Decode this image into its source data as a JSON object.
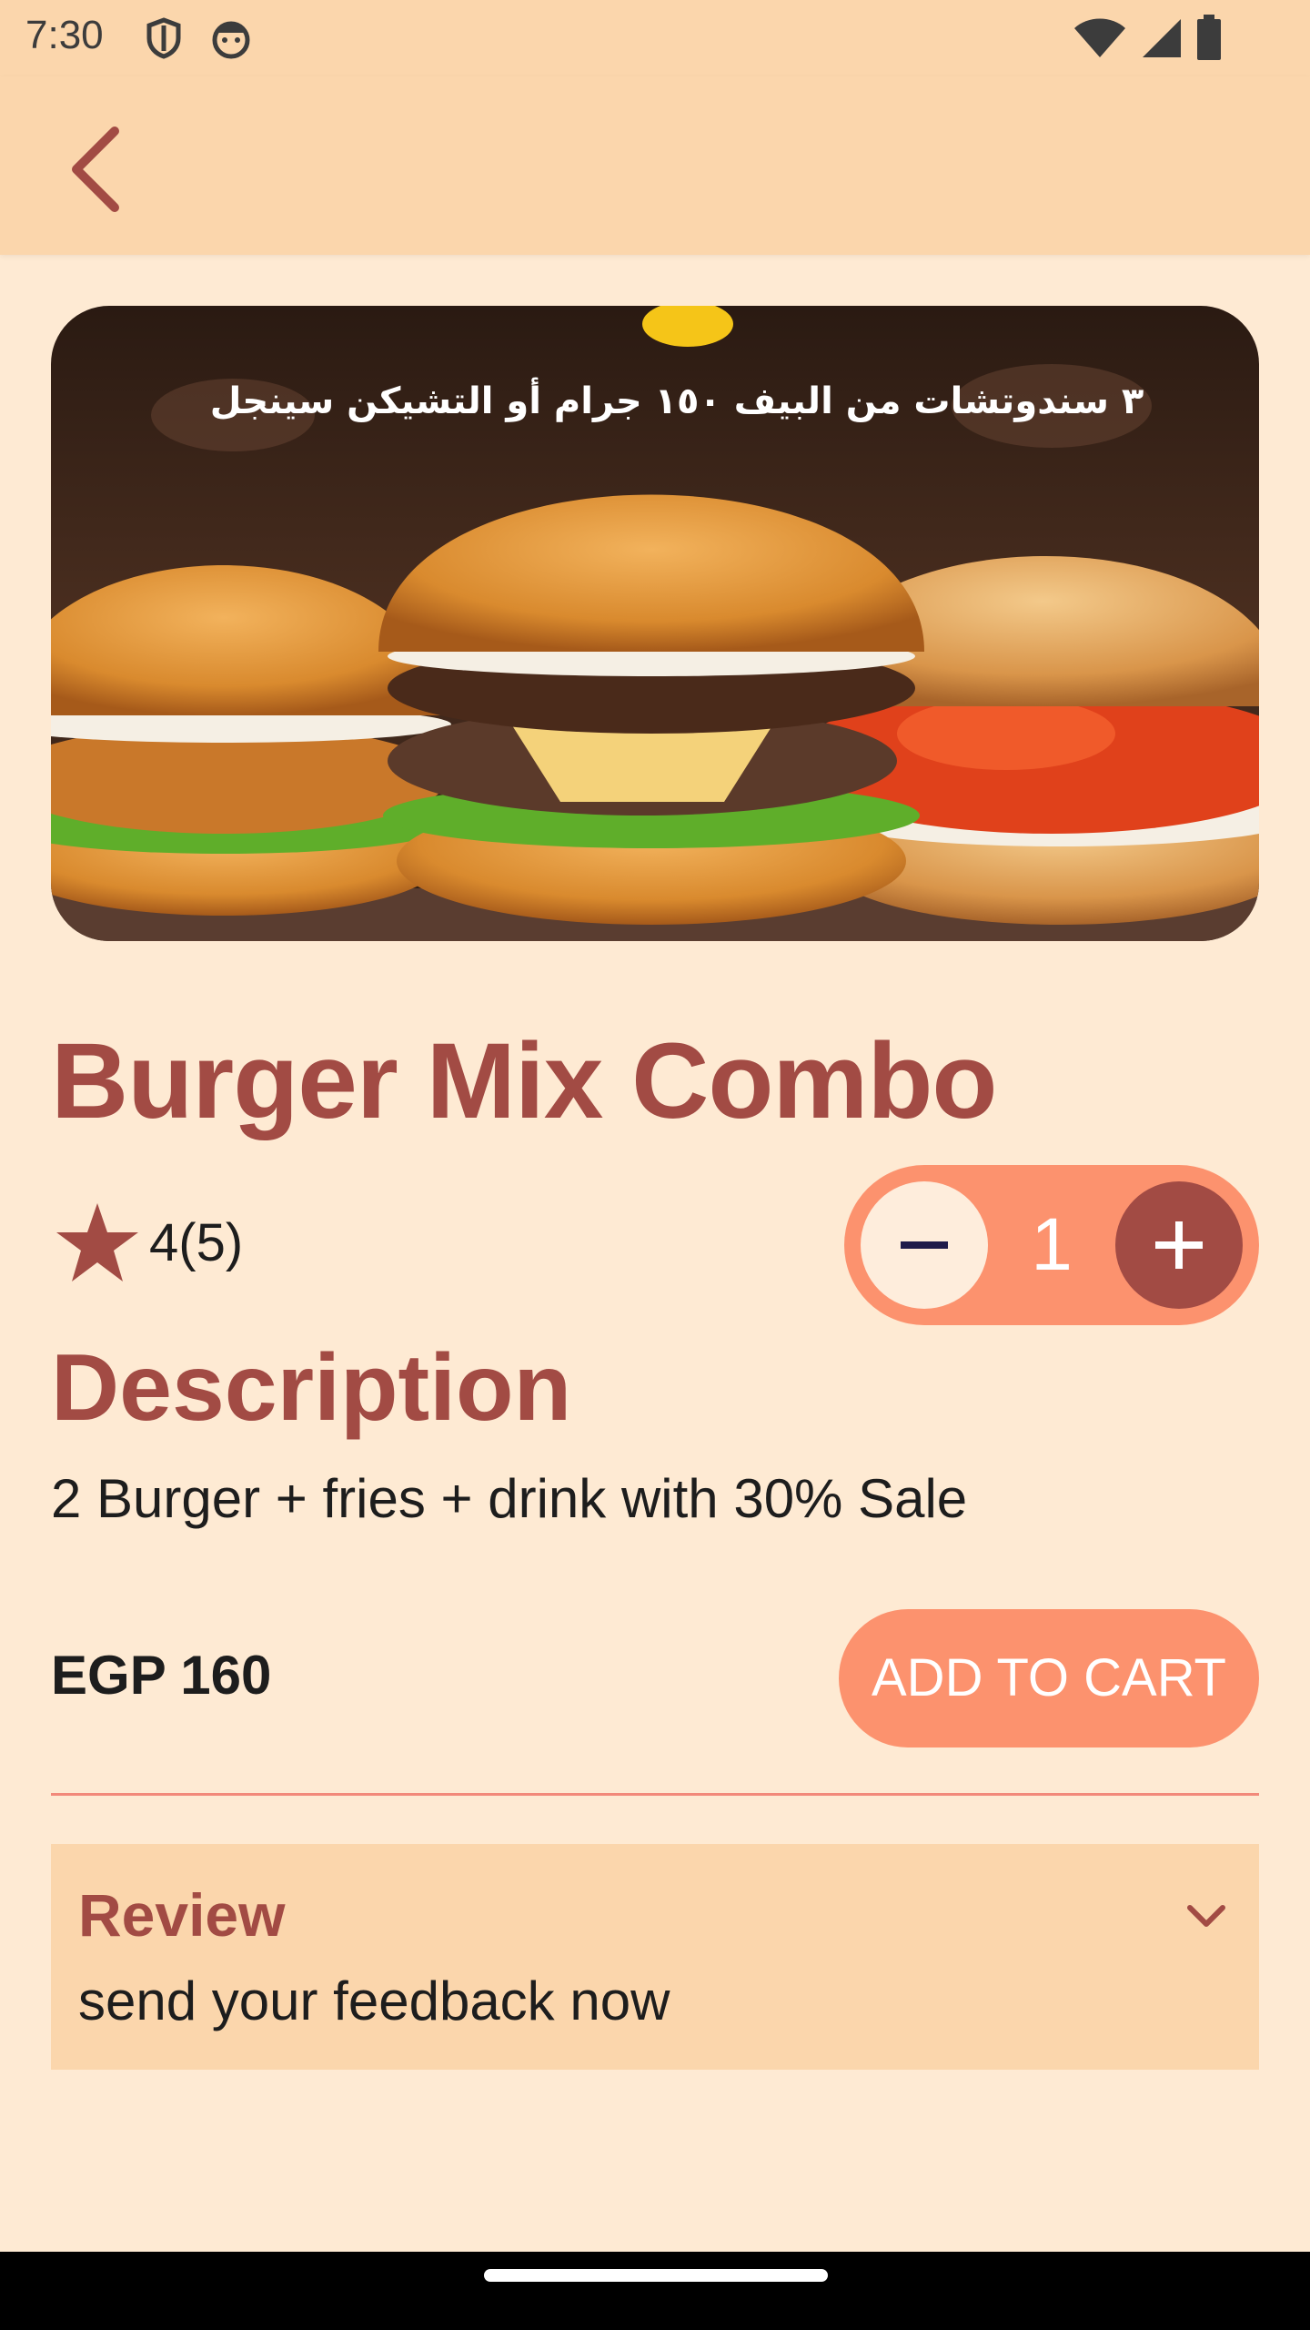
{
  "status_bar": {
    "time": "7:30",
    "icons": [
      "shield-icon",
      "face-icon",
      "wifi-icon",
      "signal-icon",
      "battery-icon"
    ]
  },
  "app_bar": {
    "back_icon": "chevron-left-icon"
  },
  "hero": {
    "banner_text": "٣ سندوتشات من البيف ١٥٠ جرام أو التشيكن سينجل",
    "image": "three-burgers-photo"
  },
  "product": {
    "title": "Burger Mix Combo",
    "rating_text": "4(5)",
    "quantity": "1",
    "description_heading": "Description",
    "description": "2 Burger + fries + drink with 30% Sale",
    "price": "EGP 160",
    "add_to_cart": "ADD TO CART"
  },
  "review": {
    "title": "Review",
    "subtitle": "send your feedback now"
  },
  "colors": {
    "accent": "#A24B44",
    "button": "#FC926E",
    "background": "#FEEAD3",
    "bar": "#FBD6AC"
  }
}
